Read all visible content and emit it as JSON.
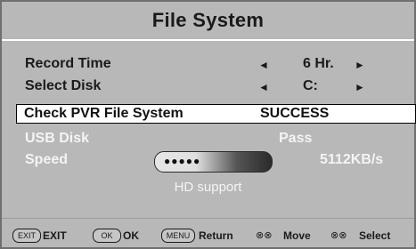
{
  "title": "File System",
  "record_time": {
    "label": "Record Time",
    "value": "6 Hr.",
    "left_arrow": "◄",
    "right_arrow": "►"
  },
  "select_disk": {
    "label": "Select Disk",
    "value": "C:",
    "left_arrow": "◄",
    "right_arrow": "►"
  },
  "check_pvr": {
    "label": "Check PVR File System",
    "status": "SUCCESS"
  },
  "usb_disk": {
    "label": "USB Disk",
    "value": "Pass"
  },
  "speed": {
    "label": "Speed",
    "value": "5112KB/s",
    "indicator": "●●●●●"
  },
  "hd_support": "HD support",
  "footer": {
    "exit_key": "EXIT",
    "exit_label": "EXIT",
    "ok_key": "OK",
    "ok_label": "OK",
    "menu_key": "MENU",
    "menu_label": "Return",
    "move_icon": "⊗⊗",
    "move_label": "Move",
    "select_icon": "⊗⊗",
    "select_label": "Select"
  }
}
